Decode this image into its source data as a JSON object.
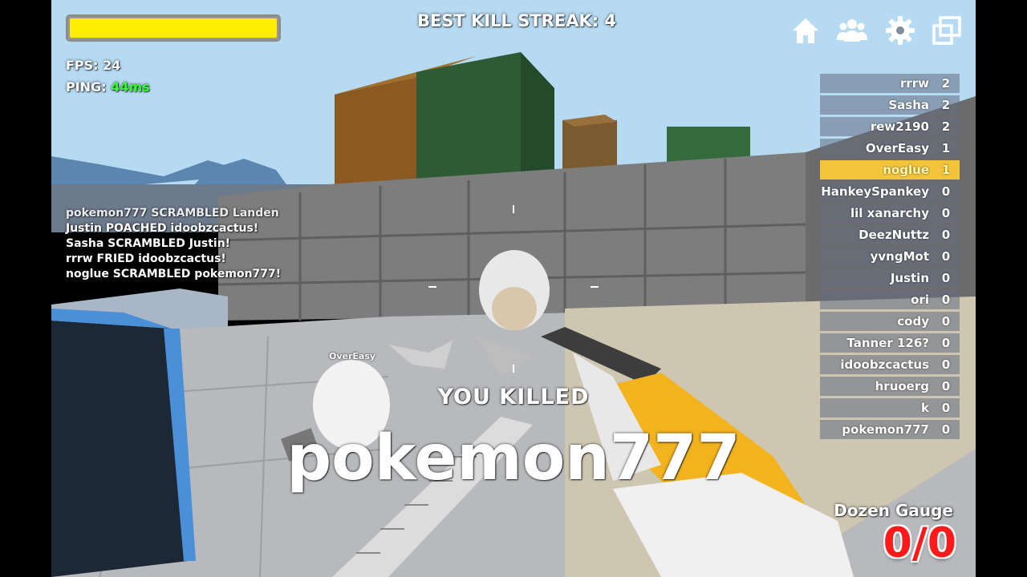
{
  "hud": {
    "health_fraction": 1.0,
    "health_color": "#ffee00",
    "best_kill_streak_label": "BEST KILL STREAK: 4",
    "fps_label": "FPS: 24",
    "ping_label": "PING:",
    "ping_value": "44ms",
    "ping_color": "#33ff33"
  },
  "top_icons": [
    "home-icon",
    "friends-icon",
    "gear-icon",
    "fullscreen-icon"
  ],
  "killfeed": [
    "pokemon777 SCRAMBLED Landen",
    "Justin POACHED idoobzcactus!",
    "Sasha SCRAMBLED Justin!",
    "rrrw FRIED idoobzcactus!",
    "noglue SCRAMBLED pokemon777!"
  ],
  "scoreboard": [
    {
      "name": "rrrw",
      "score": "2"
    },
    {
      "name": "Sasha",
      "score": "2"
    },
    {
      "name": "rew2190",
      "score": "2"
    },
    {
      "name": "OverEasy",
      "score": "1"
    },
    {
      "name": "noglue",
      "score": "1",
      "me": true
    },
    {
      "name": "HankeySpankey",
      "score": "0"
    },
    {
      "name": "lil xanarchy",
      "score": "0"
    },
    {
      "name": "DeezNuttz",
      "score": "0"
    },
    {
      "name": "yvngMot",
      "score": "0"
    },
    {
      "name": "Justin",
      "score": "0"
    },
    {
      "name": "ori",
      "score": "0"
    },
    {
      "name": "cody",
      "score": "0"
    },
    {
      "name": "Tanner 126?",
      "score": "0"
    },
    {
      "name": "idoobzcactus",
      "score": "0"
    },
    {
      "name": "hruoerg",
      "score": "0"
    },
    {
      "name": "k",
      "score": "0"
    },
    {
      "name": "pokemon777",
      "score": "0"
    }
  ],
  "highlight_color": "#f3c43a",
  "kill_notice": {
    "title": "YOU KILLED",
    "victim": "pokemon777"
  },
  "weapon": {
    "name": "Dozen Gauge",
    "ammo": "0/0",
    "ammo_color": "#ff1a1a"
  },
  "player_tag": "OverEasy"
}
